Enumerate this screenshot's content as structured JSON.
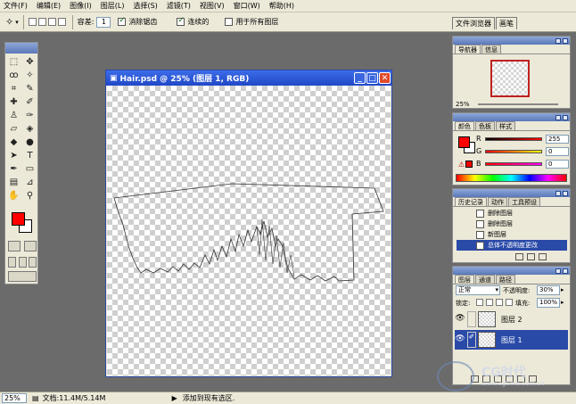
{
  "menu": [
    "文件(F)",
    "编辑(E)",
    "图像(I)",
    "图层(L)",
    "选择(S)",
    "滤镜(T)",
    "视图(V)",
    "窗口(W)",
    "帮助(H)"
  ],
  "options": {
    "tolerance_label": "容差:",
    "tolerance_value": "1",
    "antialias_label": "消除锯齿",
    "contiguous_label": "连续的",
    "all_layers_label": "用于所有图层",
    "tab_file_browser": "文件浏览器",
    "tab_brushes": "画笔"
  },
  "document": {
    "title": "Hair.psd @ 25% (图层 1, RGB)"
  },
  "navigator": {
    "tabs": [
      "导航器",
      "信息"
    ],
    "zoom": "25%"
  },
  "color": {
    "tabs": [
      "颜色",
      "色板",
      "样式"
    ],
    "r_label": "R",
    "r_value": "255",
    "g_label": "G",
    "g_value": "0",
    "b_label": "B",
    "b_value": "0",
    "fg_color": "#ff0000"
  },
  "history": {
    "tabs": [
      "历史记录",
      "动作",
      "工具预设"
    ],
    "items": [
      "删除图层",
      "删除图层",
      "新图层",
      "总体不透明度更改"
    ]
  },
  "layers": {
    "tabs": [
      "图层",
      "通道",
      "路径"
    ],
    "blend_mode": "正常",
    "opacity_label": "不透明度:",
    "opacity_value": "30%",
    "lock_label": "锁定:",
    "fill_label": "填充:",
    "fill_value": "100%",
    "items": [
      "图层 2",
      "图层 1"
    ]
  },
  "status": {
    "zoom": "25%",
    "doc_info": "文档:11.4M/5.14M",
    "hint": "添加到现有选区."
  },
  "watermark": {
    "brand": "CG时代",
    "url": "www.cgtime.com.cn"
  }
}
